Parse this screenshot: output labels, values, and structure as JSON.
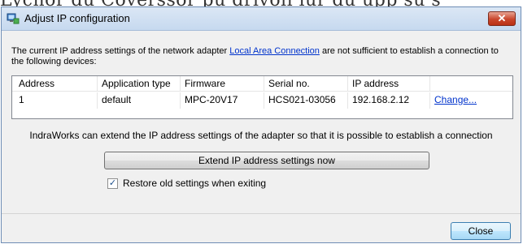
{
  "background_text": "Lychor du Coverssor pu drivoli lur du upp su s",
  "window": {
    "title": "Adjust IP configuration",
    "close_glyph": "✕"
  },
  "message": {
    "before_link": "The current IP address settings of the network adapter ",
    "link": "Local Area Connection",
    "after_link": " are not sufficient to establish a connection to the following devices:"
  },
  "table": {
    "columns": [
      "Address",
      "Application type",
      "Firmware",
      "Serial no.",
      "IP address",
      ""
    ],
    "rows": [
      {
        "address": "1",
        "application_type": "default",
        "firmware": "MPC-20V17",
        "serial": "HCS021-03056",
        "ip": "192.168.2.12",
        "action": "Change..."
      }
    ]
  },
  "info": "IndraWorks can extend the IP address settings of the adapter so that it is possible to establish a connection",
  "extend_button": "Extend IP address settings now",
  "restore_checkbox": {
    "label": "Restore old settings when exiting",
    "checked": true,
    "glyph": "✓"
  },
  "close_button": "Close",
  "icons": {
    "app": "network-config-icon",
    "close": "close-icon"
  }
}
